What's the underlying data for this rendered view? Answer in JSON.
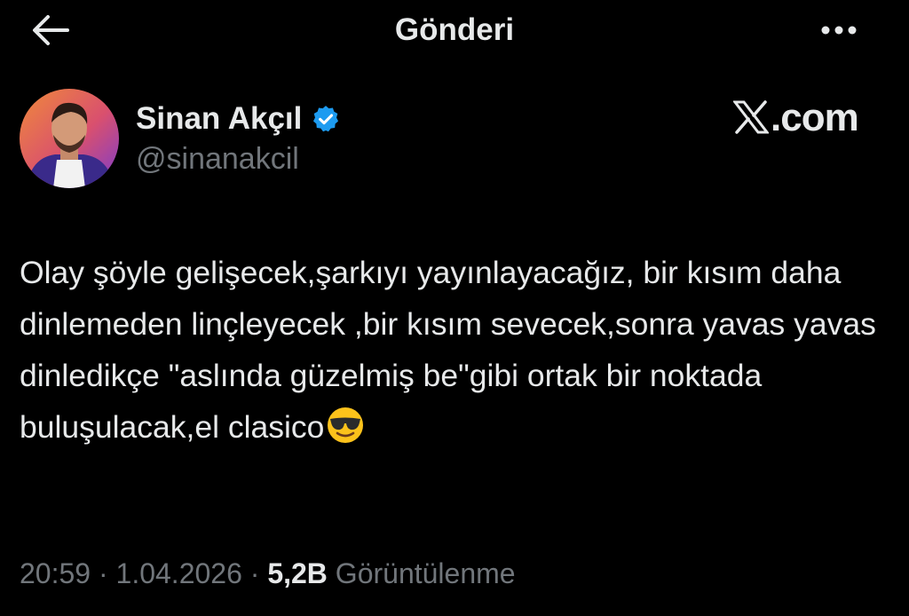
{
  "header": {
    "title": "Gönderi",
    "back_icon": "arrow-left-icon",
    "more_icon": "more-horizontal-icon"
  },
  "author": {
    "name": "Sinan Akçıl",
    "handle": "@sinanakcil",
    "verified_icon": "verified-badge-icon",
    "verified_color": "#1d9bf0"
  },
  "watermark": {
    "text": ".com",
    "logo_icon": "x-logo-icon"
  },
  "tweet": {
    "text": "Olay şöyle gelişecek,şarkıyı yayınlayacağız, bir kısım daha dinlemeden linçleyecek ,bir kısım sevecek,sonra yavas yavas dinledikçe \"aslında güzelmiş be\"gibi ortak bir noktada buluşulacak,el clasico",
    "emoji_icon": "smiling-face-with-sunglasses-icon"
  },
  "meta": {
    "time": "20:59",
    "separator": " · ",
    "date": "1.04.2026",
    "views_count": "5,2B",
    "views_label": "Görüntülenme"
  },
  "colors": {
    "background": "#000000",
    "text": "#e7e9ea",
    "secondary_text": "#71767b"
  }
}
